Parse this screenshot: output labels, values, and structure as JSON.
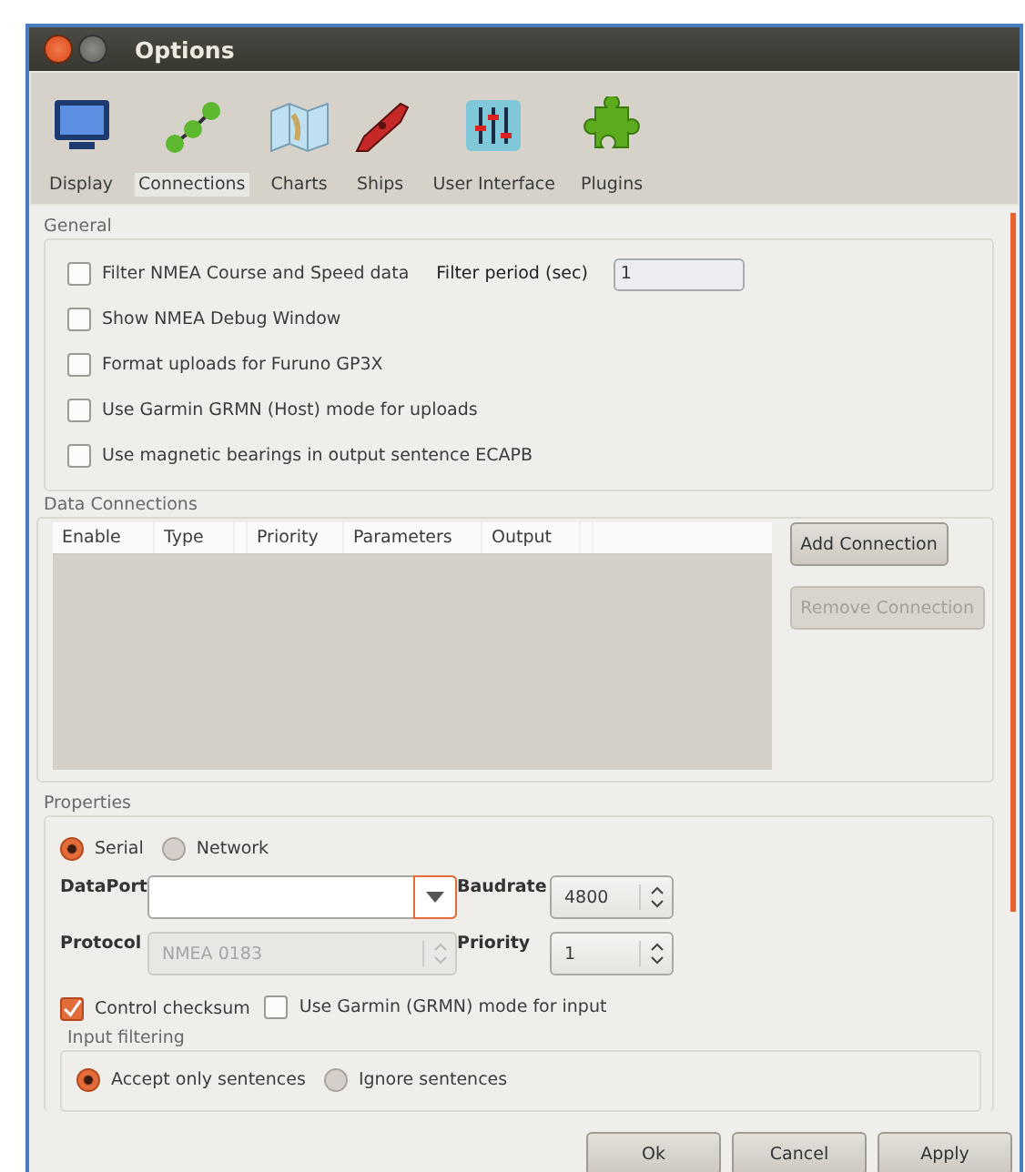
{
  "window": {
    "title": "Options"
  },
  "toolbar": [
    {
      "label": "Display",
      "kind": "display",
      "selected": false
    },
    {
      "label": "Connections",
      "kind": "connections",
      "selected": true
    },
    {
      "label": "Charts",
      "kind": "charts",
      "selected": false
    },
    {
      "label": "Ships",
      "kind": "ships",
      "selected": false
    },
    {
      "label": "User Interface",
      "kind": "ui",
      "selected": false
    },
    {
      "label": "Plugins",
      "kind": "plugins",
      "selected": false
    }
  ],
  "general": {
    "title": "General",
    "filter_period": {
      "label": "Filter period (sec)",
      "value": "1"
    },
    "options": [
      {
        "label": "Filter NMEA Course and Speed data",
        "checked": false
      },
      {
        "label": "Show NMEA Debug Window",
        "checked": false
      },
      {
        "label": "Format uploads for Furuno GP3X",
        "checked": false
      },
      {
        "label": "Use Garmin GRMN (Host) mode for uploads",
        "checked": false
      },
      {
        "label": "Use magnetic bearings in output sentence ECAPB",
        "checked": false
      }
    ]
  },
  "data_connections": {
    "title": "Data Connections",
    "columns": [
      {
        "label": "Enable"
      },
      {
        "label": "Type"
      },
      {
        "cut": true
      },
      {
        "label": "Priority"
      },
      {
        "label": "Parameters"
      },
      {
        "label": "Output"
      },
      {
        "cut": true
      }
    ],
    "buttons": [
      {
        "label": "Add Connection",
        "disabled": false
      },
      {
        "label": "Remove Connection",
        "disabled": true
      }
    ]
  },
  "properties": {
    "title": "Properties",
    "interface": [
      {
        "label": "Serial",
        "selected": true
      },
      {
        "label": "Network",
        "selected": false
      }
    ],
    "fields": [
      {
        "label": "DataPort",
        "kind": "combo",
        "focused": true,
        "disabled": false
      },
      {
        "label": "Baudrate",
        "kind": "spin",
        "value": "4800",
        "disabled": false
      },
      {
        "label": "Protocol",
        "kind": "combo",
        "value": "NMEA 0183",
        "focused": false,
        "disabled": true
      },
      {
        "label": "Priority",
        "kind": "spin",
        "value": "1",
        "disabled": false
      }
    ],
    "checks": [
      {
        "label": "Control checksum",
        "checked": true
      },
      {
        "label": "Use Garmin (GRMN) mode for input",
        "checked": false
      }
    ],
    "input_filtering": {
      "title": "Input filtering",
      "options": [
        {
          "label": "Accept only sentences",
          "selected": true
        },
        {
          "label": "Ignore sentences",
          "selected": false
        }
      ]
    }
  },
  "dialog_buttons": [
    {
      "label": "Ok"
    },
    {
      "label": "Cancel"
    },
    {
      "label": "Apply"
    }
  ]
}
